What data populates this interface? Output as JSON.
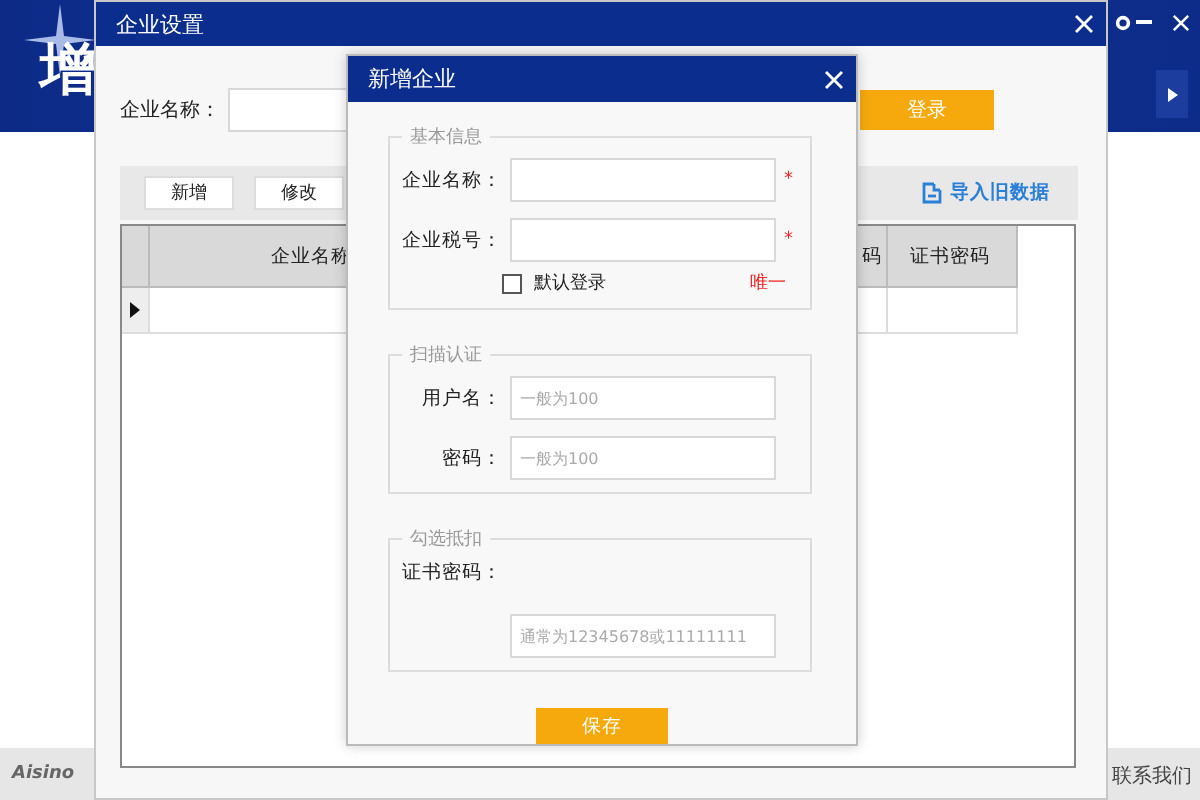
{
  "app": {
    "title": "增",
    "footer_logo": "Aisino",
    "footer_link": "联系我们"
  },
  "settings_window": {
    "title": "企业设置",
    "search_label": "企业名称：",
    "login_button": "登录",
    "toolbar": {
      "buttons": [
        "新增",
        "修改"
      ],
      "import_link": "导入旧数据"
    },
    "table": {
      "columns": [
        {
          "label": "企业名称"
        },
        {
          "label": "码"
        },
        {
          "label": "证书密码"
        }
      ],
      "rows": [
        {
          "selected": true
        }
      ]
    }
  },
  "dialog": {
    "title": "新增企业",
    "sections": [
      {
        "legend": "基本信息",
        "fields": [
          {
            "label": "企业名称：",
            "mark": "*",
            "kind": "inline"
          },
          {
            "label": "企业税号：",
            "mark": "*",
            "kind": "inline"
          }
        ],
        "checkbox": {
          "label": "默认登录",
          "checked": false
        },
        "note": "唯一"
      },
      {
        "legend": "扫描认证",
        "fields": [
          {
            "label": "用户名：",
            "placeholder": "一般为100",
            "kind": "inline"
          },
          {
            "label": "密码：",
            "placeholder": "一般为100",
            "kind": "inline"
          }
        ]
      },
      {
        "legend": "勾选抵扣",
        "fields": [
          {
            "label": "证书密码：",
            "placeholder": "通常为12345678或11111111",
            "kind": "stacked"
          }
        ]
      }
    ],
    "save_button": "保存"
  }
}
